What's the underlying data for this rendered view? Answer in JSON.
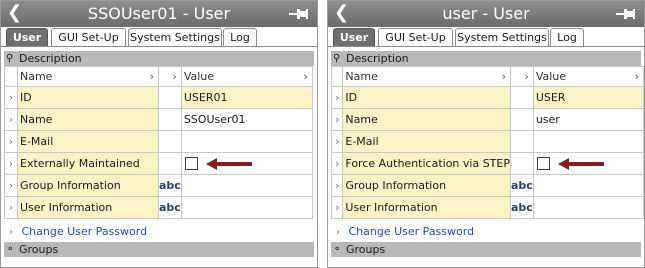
{
  "colors": {
    "titlebar": "#7a7a7a",
    "active_tab": "#6f6f6f",
    "section_header": "#b8b8b8",
    "editable_cell": "#fbf3c6",
    "link": "#1f4fb5",
    "arrow": "#8b1a1a"
  },
  "panels": [
    {
      "title": "SSOUser01 - User",
      "back_icon": "chevron-left-icon",
      "pin_icon": "pin-icon",
      "tabs": [
        {
          "label": "User",
          "active": true
        },
        {
          "label": "GUI Set-Up",
          "active": false
        },
        {
          "label": "System Settings",
          "active": false
        },
        {
          "label": "Log",
          "active": false
        }
      ],
      "description_section": "Description",
      "grid_header": {
        "name": "Name",
        "value": "Value"
      },
      "rows": [
        {
          "name": "ID",
          "value": "USER01",
          "abc": "",
          "checkbox": false
        },
        {
          "name": "Name",
          "value": "SSOUser01",
          "abc": "",
          "checkbox": false
        },
        {
          "name": "E-Mail",
          "value": "",
          "abc": "",
          "checkbox": false
        },
        {
          "name": "Externally Maintained",
          "value": "",
          "abc": "",
          "checkbox": true,
          "checked": false,
          "arrow": true
        },
        {
          "name": "Group Information",
          "value": "",
          "abc": "abc",
          "checkbox": false
        },
        {
          "name": "User Information",
          "value": "",
          "abc": "abc",
          "checkbox": false
        }
      ],
      "change_password_link": "Change User Password",
      "groups_section": "Groups"
    },
    {
      "title": "user - User",
      "back_icon": "chevron-left-icon",
      "pin_icon": "pin-icon",
      "tabs": [
        {
          "label": "User",
          "active": true
        },
        {
          "label": "GUI Set-Up",
          "active": false
        },
        {
          "label": "System Settings",
          "active": false
        },
        {
          "label": "Log",
          "active": false
        }
      ],
      "description_section": "Description",
      "grid_header": {
        "name": "Name",
        "value": "Value"
      },
      "rows": [
        {
          "name": "ID",
          "value": "USER",
          "abc": "",
          "checkbox": false
        },
        {
          "name": "Name",
          "value": "user",
          "abc": "",
          "checkbox": false
        },
        {
          "name": "E-Mail",
          "value": "",
          "abc": "",
          "checkbox": false
        },
        {
          "name": "Force Authentication via STEP",
          "value": "",
          "abc": "",
          "checkbox": true,
          "checked": false,
          "arrow": true
        },
        {
          "name": "Group Information",
          "value": "",
          "abc": "abc",
          "checkbox": false
        },
        {
          "name": "User Information",
          "value": "",
          "abc": "abc",
          "checkbox": false
        }
      ],
      "change_password_link": "Change User Password",
      "groups_section": "Groups"
    }
  ]
}
